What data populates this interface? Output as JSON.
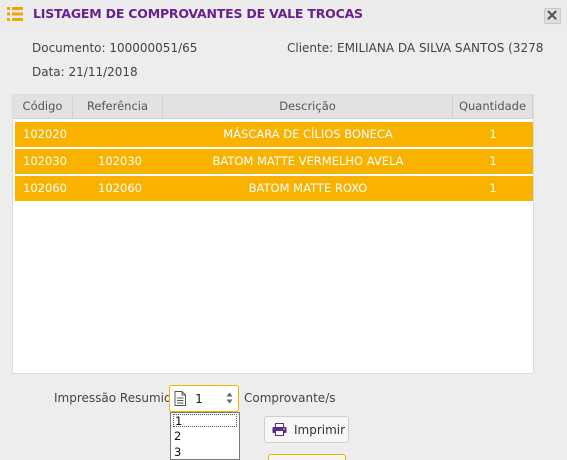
{
  "window": {
    "title": "LISTAGEM DE COMPROVANTES DE VALE TROCAS",
    "title_icon": "list-icon",
    "close_icon": "close-icon",
    "accent_color": "#6a1f8e"
  },
  "info": {
    "documento": "Documento: 100000051/65",
    "cliente": "Cliente: EMILIANA DA SILVA SANTOS (3278",
    "data": "Data: 21/11/2018"
  },
  "table": {
    "columns": [
      "Código",
      "Referência",
      "Descrição",
      "Quantidade"
    ],
    "row_color": "#fab200",
    "rows": [
      {
        "codigo": "102020",
        "referencia": "",
        "descricao": "MÁSCARA DE CÍLIOS BONECA",
        "quantidade": "1"
      },
      {
        "codigo": "102030",
        "referencia": "102030",
        "descricao": "BATOM MATTE VERMELHO AVELA",
        "quantidade": "1"
      },
      {
        "codigo": "102060",
        "referencia": "102060",
        "descricao": "BATOM MATTE ROXO",
        "quantidade": "1"
      }
    ]
  },
  "footer": {
    "impressao_label": "Impressão Resumida:",
    "select_value": "1",
    "select_options": [
      "1",
      "2",
      "3"
    ],
    "comprovante_label": "Comprovante/s",
    "print_button_label": "Imprimir",
    "print_icon": "printer-icon"
  }
}
